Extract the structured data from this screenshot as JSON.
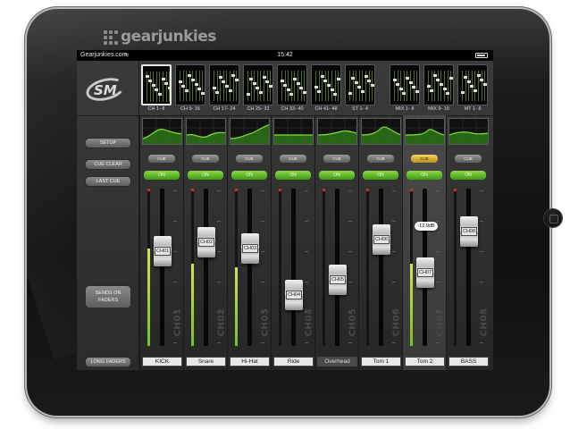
{
  "watermark": {
    "text": "gearjunkies"
  },
  "status_bar": {
    "carrier": "Gearjunkies.com",
    "time": "15:42"
  },
  "banks": [
    {
      "label": "CH 1- 8",
      "selected": true
    },
    {
      "label": "CH 9- 16",
      "selected": false
    },
    {
      "label": "CH 17- 24",
      "selected": false
    },
    {
      "label": "CH 25- 32",
      "selected": false
    },
    {
      "label": "CH 33- 40",
      "selected": false
    },
    {
      "label": "CH 41- 48",
      "selected": false
    },
    {
      "label": "ST 1- 4",
      "selected": false
    },
    {
      "label": "MIX 1- 8",
      "selected": false
    },
    {
      "label": "MIX 9- 16",
      "selected": false
    },
    {
      "label": "MT 1- 8",
      "selected": false
    }
  ],
  "left_panel": {
    "logo_text": "SM",
    "setup": "SETUP",
    "cue_clear": "CUE CLEAR",
    "last_cue": "LAST CUE",
    "sends_on_faders_1": "SENDS ON",
    "sends_on_faders_2": "FADERS",
    "long_faders": "LONG FADERS"
  },
  "channels": [
    {
      "id": "CH01",
      "name": "KICK",
      "cue": "CUE",
      "on": "ON",
      "cue_active": false,
      "fader_level": 0.63,
      "meter_level": 0.62,
      "name_dark": false
    },
    {
      "id": "CH02",
      "name": "Snare",
      "cue": "CUE",
      "on": "ON",
      "cue_active": false,
      "fader_level": 0.7,
      "meter_level": 0.52,
      "name_dark": false
    },
    {
      "id": "CH03",
      "name": "Hi-Hat",
      "cue": "CUE",
      "on": "ON",
      "cue_active": false,
      "fader_level": 0.65,
      "meter_level": 0.5,
      "name_dark": false
    },
    {
      "id": "CH04",
      "name": "Ride",
      "cue": "CUE",
      "on": "ON",
      "cue_active": false,
      "fader_level": 0.28,
      "meter_level": 0.0,
      "name_dark": false
    },
    {
      "id": "CH05",
      "name": "Overhead",
      "cue": "CUE",
      "on": "ON",
      "cue_active": false,
      "fader_level": 0.4,
      "meter_level": 0.0,
      "name_dark": true
    },
    {
      "id": "CH06",
      "name": "Tom 1",
      "cue": "CUE",
      "on": "ON",
      "cue_active": false,
      "fader_level": 0.72,
      "meter_level": 0.0,
      "name_dark": false
    },
    {
      "id": "CH07",
      "name": "Tom 2",
      "cue": "CUE",
      "on": "ON",
      "cue_active": true,
      "fader_level": 0.46,
      "meter_level": 0.52,
      "name_dark": false,
      "readout": "-12.9dB"
    },
    {
      "id": "CH08",
      "name": "BASS",
      "cue": "CUE",
      "on": "ON",
      "cue_active": false,
      "fader_level": 0.78,
      "meter_level": 0.0,
      "name_dark": false
    }
  ],
  "colors": {
    "on_green": "#5cbf22",
    "cue_yellow": "#e1bd3c",
    "meter_green": "#8ad038",
    "peak_red": "#c8302a"
  }
}
